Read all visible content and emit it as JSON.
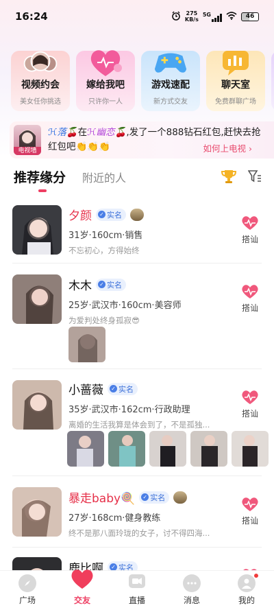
{
  "status_bar": {
    "time": "16:24",
    "speed_value": "275",
    "speed_unit": "KB/s",
    "network": "5G",
    "battery": "46"
  },
  "feature_cards": [
    {
      "title": "视频约会",
      "subtitle": "美女任你挑选",
      "icon": "women-avatars-icon"
    },
    {
      "title": "嫁给我吧",
      "subtitle": "只许你一人",
      "icon": "heart-icon"
    },
    {
      "title": "游戏速配",
      "subtitle": "新方式交友",
      "icon": "gamepad-icon"
    },
    {
      "title": "聊天室",
      "subtitle": "免费群聊广场",
      "icon": "chat-room-icon"
    }
  ],
  "banner": {
    "badge_label": "电视墙",
    "sender": "ℋ落🍒",
    "text_in": "在",
    "receiver": "ℋ幽恋🍒",
    "message": ",发了一个888钻石红包,赶快去抢红包吧👏👏👏",
    "link": "如何上电视 ›"
  },
  "tabs": {
    "active": "推荐缘分",
    "inactive": "附近的人",
    "trophy_icon": "trophy-icon",
    "filter_icon": "filter-icon"
  },
  "users": [
    {
      "name": "夕颜",
      "highlight": true,
      "verified": "实名",
      "medal": true,
      "detail": "31岁·160cm·销售",
      "quote": "不忘初心，方得始终",
      "greet": "搭讪",
      "photos": 0
    },
    {
      "name": "木木",
      "highlight": false,
      "verified": "实名",
      "medal": false,
      "detail": "25岁·武汉市·160cm·美容师",
      "quote": "为爱判处终身孤寂😎",
      "greet": "搭讪",
      "photos": 1
    },
    {
      "name": "小蔷薇",
      "highlight": false,
      "verified": "实名",
      "medal": false,
      "detail": "35岁·武汉市·162cm·行政助理",
      "quote": "离婚的生活我算是体会到了，不是孤独...",
      "greet": "搭讪",
      "photos": 5
    },
    {
      "name": "暴走baby🍭",
      "highlight": true,
      "verified": "实名",
      "medal": true,
      "detail": "27岁·168cm·健身教练",
      "quote": "终不是那八面玲珑的女子，讨不得四海...",
      "greet": "搭讪",
      "photos": 0
    },
    {
      "name": "鹿比啊",
      "highlight": false,
      "verified": "实名",
      "medal": false,
      "detail": "",
      "quote": "",
      "greet": "搭讪",
      "photos": 0
    }
  ],
  "bottom_nav": [
    {
      "label": "广场",
      "icon": "compass-icon",
      "active": false
    },
    {
      "label": "交友",
      "icon": "heart-icon",
      "active": true
    },
    {
      "label": "直播",
      "icon": "video-camera-icon",
      "active": false
    },
    {
      "label": "消息",
      "icon": "message-bubble-icon",
      "active": false
    },
    {
      "label": "我的",
      "icon": "profile-icon",
      "active": false
    }
  ],
  "colors": {
    "accent": "#ee3e62",
    "verify_blue": "#3b6fd8",
    "highlight_name": "#e63049"
  }
}
